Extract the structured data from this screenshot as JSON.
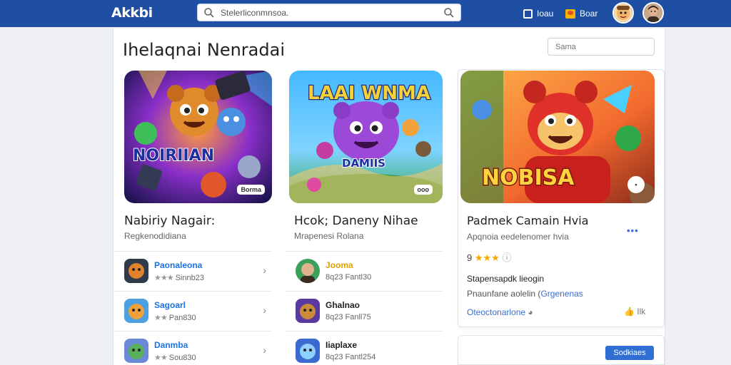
{
  "header": {
    "brand": "Akkbi",
    "search_text": "Stelerliconmnsoa.",
    "nav_link_1": "Ioau",
    "nav_link_2": "Boar"
  },
  "main": {
    "title": "Ihelaqnai Nenradai",
    "filter_placeholder": "Sama"
  },
  "columns": [
    {
      "banner_text": "NOIRIIAN",
      "banner_badge": "Borma",
      "title": "Nabiriy Nagair:",
      "subtitle": "Regkenodidiana",
      "rows": [
        {
          "name": "Paonaleona",
          "meta": "Sinnb23",
          "color": "#1a73e8"
        },
        {
          "name": "Sagoarl",
          "meta": "Pan830",
          "color": "#1a73e8"
        },
        {
          "name": "Danmba",
          "meta": "Sou830",
          "color": "#1a73e8"
        }
      ]
    },
    {
      "banner_text": "LAAI WNMA",
      "banner_sub": "DAMIIS",
      "banner_badge": "ooo",
      "title": "Hcok; Daneny Nihae",
      "subtitle": "Mrapenesi Rolana",
      "rows": [
        {
          "name": "Jooma",
          "meta": "8q23 Fantl30",
          "color": "#e0a100"
        },
        {
          "name": "Ghalnao",
          "meta": "8q23 Fanll75",
          "color": "#222222"
        },
        {
          "name": "Iiaplaxe",
          "meta": "8q23 Fantl254",
          "color": "#222222"
        }
      ]
    }
  ],
  "detail": {
    "banner_text": "NOBISA",
    "title": "Padmek Camain Hvia",
    "subtitle": "Apqnoia eedelenomer hvia",
    "rating_prefix": "9",
    "info": "Stapensapdk lieogin",
    "desc_1": "Pnaunfane aolelin",
    "desc_2": "Grgenenas",
    "link": "Oteoctonarlone",
    "like": "Ilk",
    "button": "Sodkiaes"
  },
  "colors": {
    "topbar": "#1e4fa3",
    "accent": "#2f6fd3",
    "star": "#f2a900"
  }
}
